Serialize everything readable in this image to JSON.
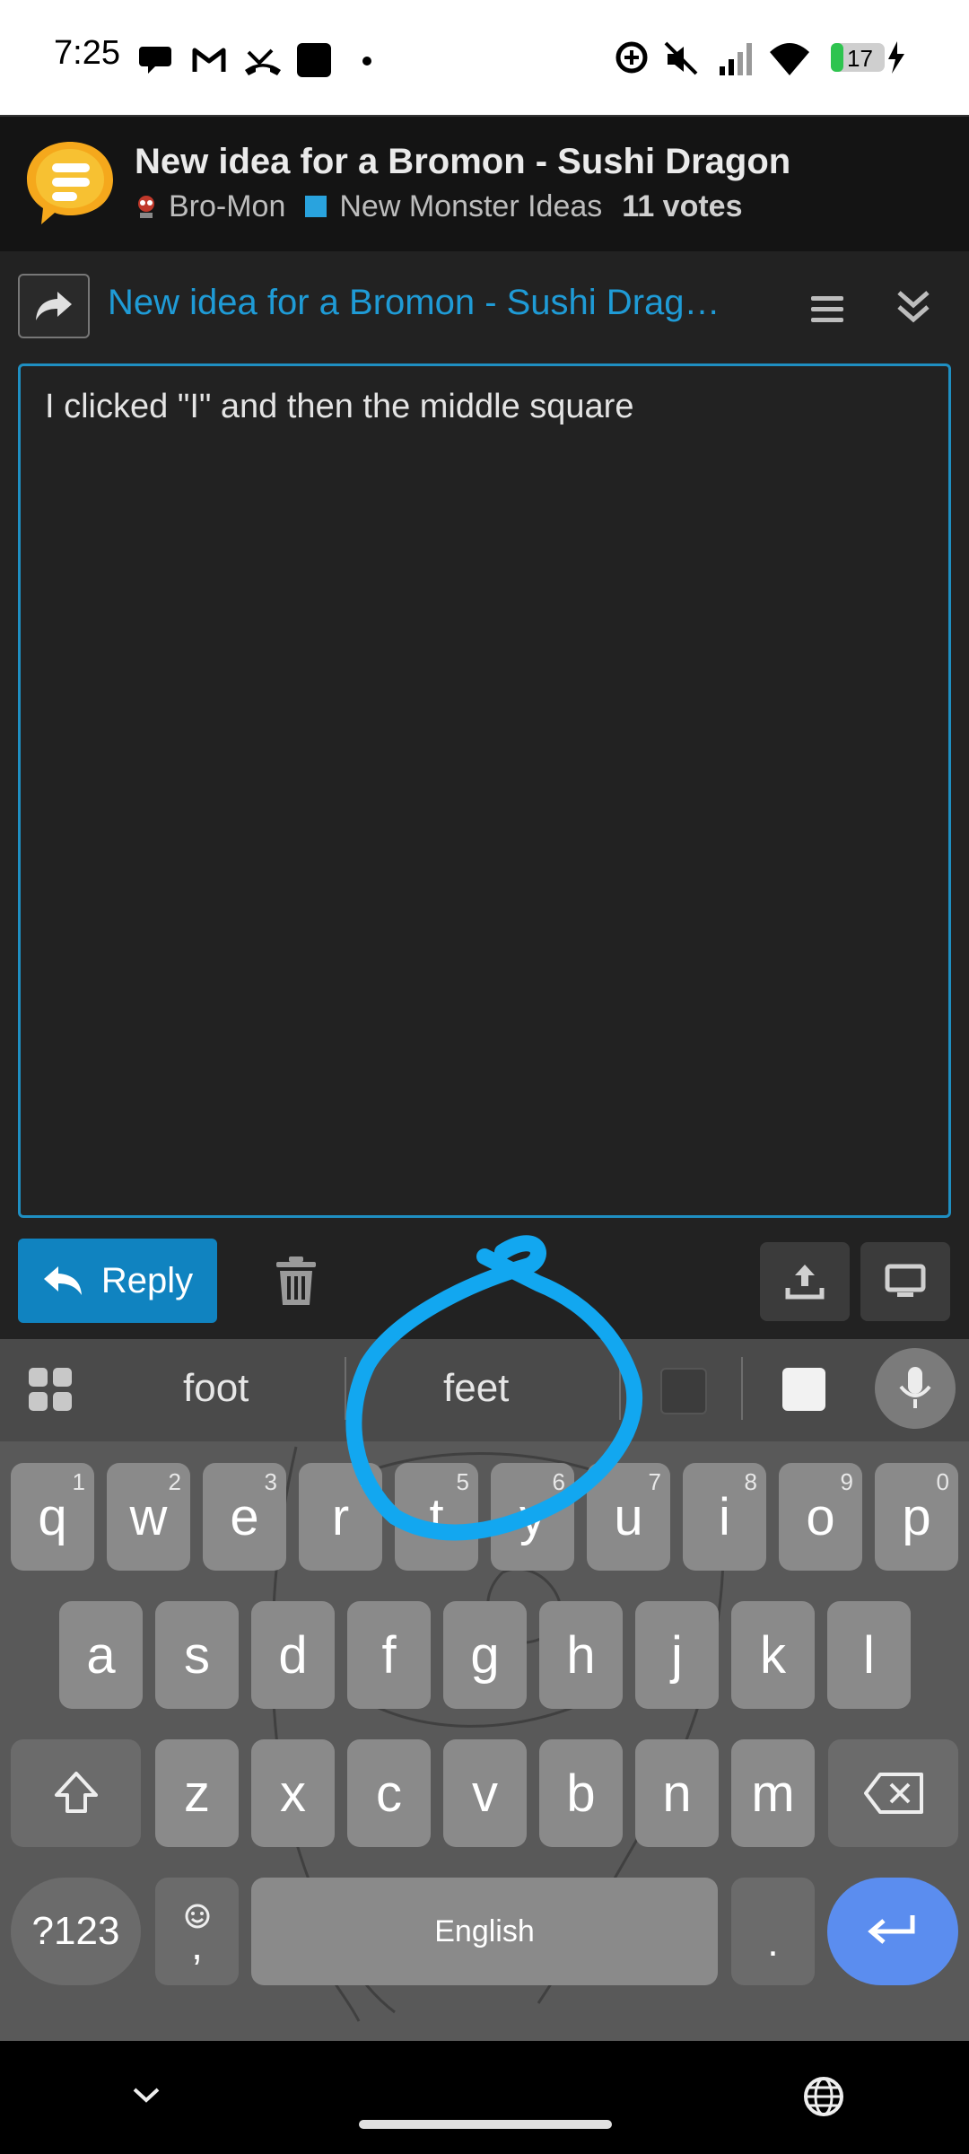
{
  "status_bar": {
    "time": "7:25",
    "battery": "17",
    "icons": [
      "chat-icon",
      "gmail-icon",
      "missed-call-icon",
      "app-square-icon",
      "dot-icon",
      "data-saver-icon",
      "mute-icon",
      "signal-icon",
      "wifi-icon",
      "battery-icon",
      "charging-icon"
    ]
  },
  "topic": {
    "title": "New idea for a Bromon - Sushi Dragon",
    "parent_category": "Bro-Mon",
    "category": "New Monster Ideas",
    "category_color": "#29a3de",
    "votes": "11 votes"
  },
  "composer": {
    "reply_to_title": "New idea for a Bromon - Sushi Drag…",
    "text": "I clicked \"I\" and then the middle square",
    "reply_label": "Reply",
    "accent": "#1083c0"
  },
  "keyboard": {
    "suggestions": [
      "foot",
      "feet"
    ],
    "row1": [
      {
        "k": "q",
        "n": "1"
      },
      {
        "k": "w",
        "n": "2"
      },
      {
        "k": "e",
        "n": "3"
      },
      {
        "k": "r",
        "n": "4"
      },
      {
        "k": "t",
        "n": "5"
      },
      {
        "k": "y",
        "n": "6"
      },
      {
        "k": "u",
        "n": "7"
      },
      {
        "k": "i",
        "n": "8"
      },
      {
        "k": "o",
        "n": "9"
      },
      {
        "k": "p",
        "n": "0"
      }
    ],
    "row2": [
      "a",
      "s",
      "d",
      "f",
      "g",
      "h",
      "j",
      "k",
      "l"
    ],
    "row3": [
      "z",
      "x",
      "c",
      "v",
      "b",
      "n",
      "m"
    ],
    "symbols_label": "?123",
    "comma_label": ",",
    "space_label": "English",
    "period_label": ".",
    "enter_color": "#5b8def"
  },
  "annotation": {
    "color": "#12a7f0",
    "description_target": "middle suggestion"
  }
}
